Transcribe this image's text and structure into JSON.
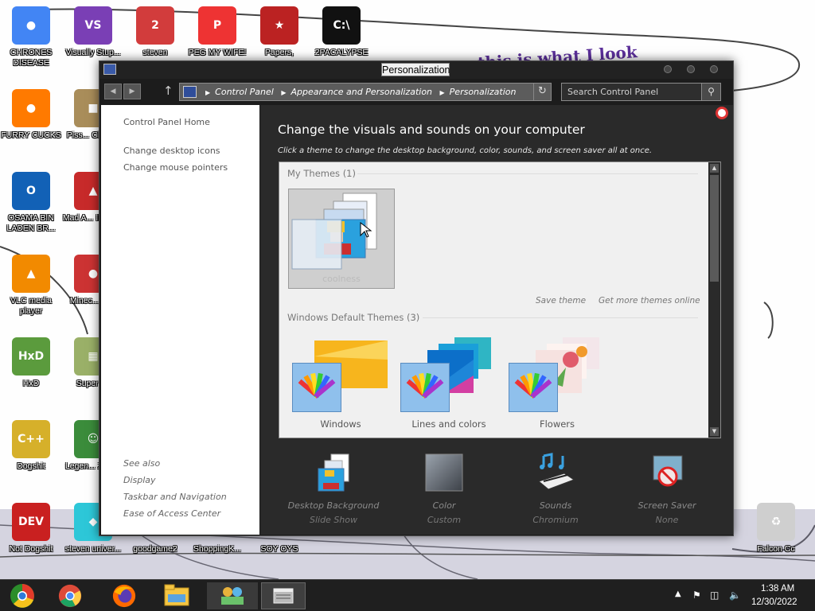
{
  "desktop": {
    "icons": [
      {
        "label": "CHRONES DISEASE",
        "icon": "chrome-icon"
      },
      {
        "label": "Visually Stup...",
        "icon": "visual-studio-icon"
      },
      {
        "label": "steven",
        "icon": "steven-icon"
      },
      {
        "label": "PEG MY WIFE!",
        "icon": "peg-icon"
      },
      {
        "label": "Papers,",
        "icon": "papers-icon"
      },
      {
        "label": "2PACALYPSE",
        "icon": "cmd-icon"
      },
      {
        "label": "FURRY CUCKS",
        "icon": "firefox-icon"
      },
      {
        "label": "Piss... Chick...",
        "icon": "game-icon"
      },
      {
        "label": "OSAMA BIN LADEN BR...",
        "icon": "obama-logo-icon"
      },
      {
        "label": "Mad A... IN SP...",
        "icon": "angry-birds-space-icon"
      },
      {
        "label": "VLC media player",
        "icon": "vlc-icon"
      },
      {
        "label": "Minec... Bird",
        "icon": "angry-bird-icon"
      },
      {
        "label": "HxD",
        "icon": "hxd-icon"
      },
      {
        "label": "Super I...",
        "icon": "pixel-game-icon"
      },
      {
        "label": "Dogshit",
        "icon": "cpp-icon"
      },
      {
        "label": "Legen... Zeld...",
        "icon": "zelda-icon"
      },
      {
        "label": "Not Dogshit",
        "icon": "dev-cpp-icon"
      },
      {
        "label": "steven univer...",
        "icon": "diamond-icon"
      },
      {
        "label": "goodgame2",
        "icon": "file-icon"
      },
      {
        "label": "ShoppingK...",
        "icon": "file-icon"
      },
      {
        "label": "SOY OYS",
        "icon": "file-icon"
      },
      {
        "label": "Falcon Cc",
        "icon": "recycle-bin-icon"
      }
    ],
    "wallpaper_text": "this is what I look"
  },
  "window": {
    "title": "Personalization",
    "breadcrumbs": [
      "Control Panel",
      "Appearance and Personalization",
      "Personalization"
    ],
    "search_placeholder": "Search Control Panel",
    "left_links": [
      "Control Panel Home",
      "Change desktop icons",
      "Change mouse pointers"
    ],
    "see_also_title": "See also",
    "see_also_links": [
      "Display",
      "Taskbar and Navigation",
      "Ease of Access Center"
    ],
    "heading": "Change the visuals and sounds on your computer",
    "subheading": "Click a theme to change the desktop background, color, sounds, and screen saver all at once.",
    "my_themes_title": "My Themes (1)",
    "my_theme_name": "coolness",
    "save_theme": "Save theme",
    "get_more_themes": "Get more themes online",
    "default_themes_title": "Windows Default Themes (3)",
    "default_themes": [
      {
        "name": "Windows",
        "accent": "#f7a81b"
      },
      {
        "name": "Lines and colors",
        "accent": "#1e86d8"
      },
      {
        "name": "Flowers",
        "accent": "#e05b6b"
      }
    ],
    "bottom_items": [
      {
        "name": "Desktop Background",
        "value": "Slide Show",
        "icon": "desktop-background-icon"
      },
      {
        "name": "Color",
        "value": "Custom",
        "icon": "color-swatch-icon"
      },
      {
        "name": "Sounds",
        "value": "Chromium",
        "icon": "sounds-keyboard-icon"
      },
      {
        "name": "Screen Saver",
        "value": "None",
        "icon": "screen-saver-icon"
      }
    ]
  },
  "taskbar": {
    "items": [
      "start-button",
      "chrome-icon",
      "firefox-icon",
      "file-explorer-icon",
      "control-panel-icon",
      "active-window-icon"
    ],
    "time": "1:38 AM",
    "date": "12/30/2022"
  },
  "colors": {
    "window_dark": "#1c1c1c",
    "main_pane": "#2a2a2a",
    "themes_box": "#f0f0f0",
    "taskbar": "#1f1f1f"
  }
}
